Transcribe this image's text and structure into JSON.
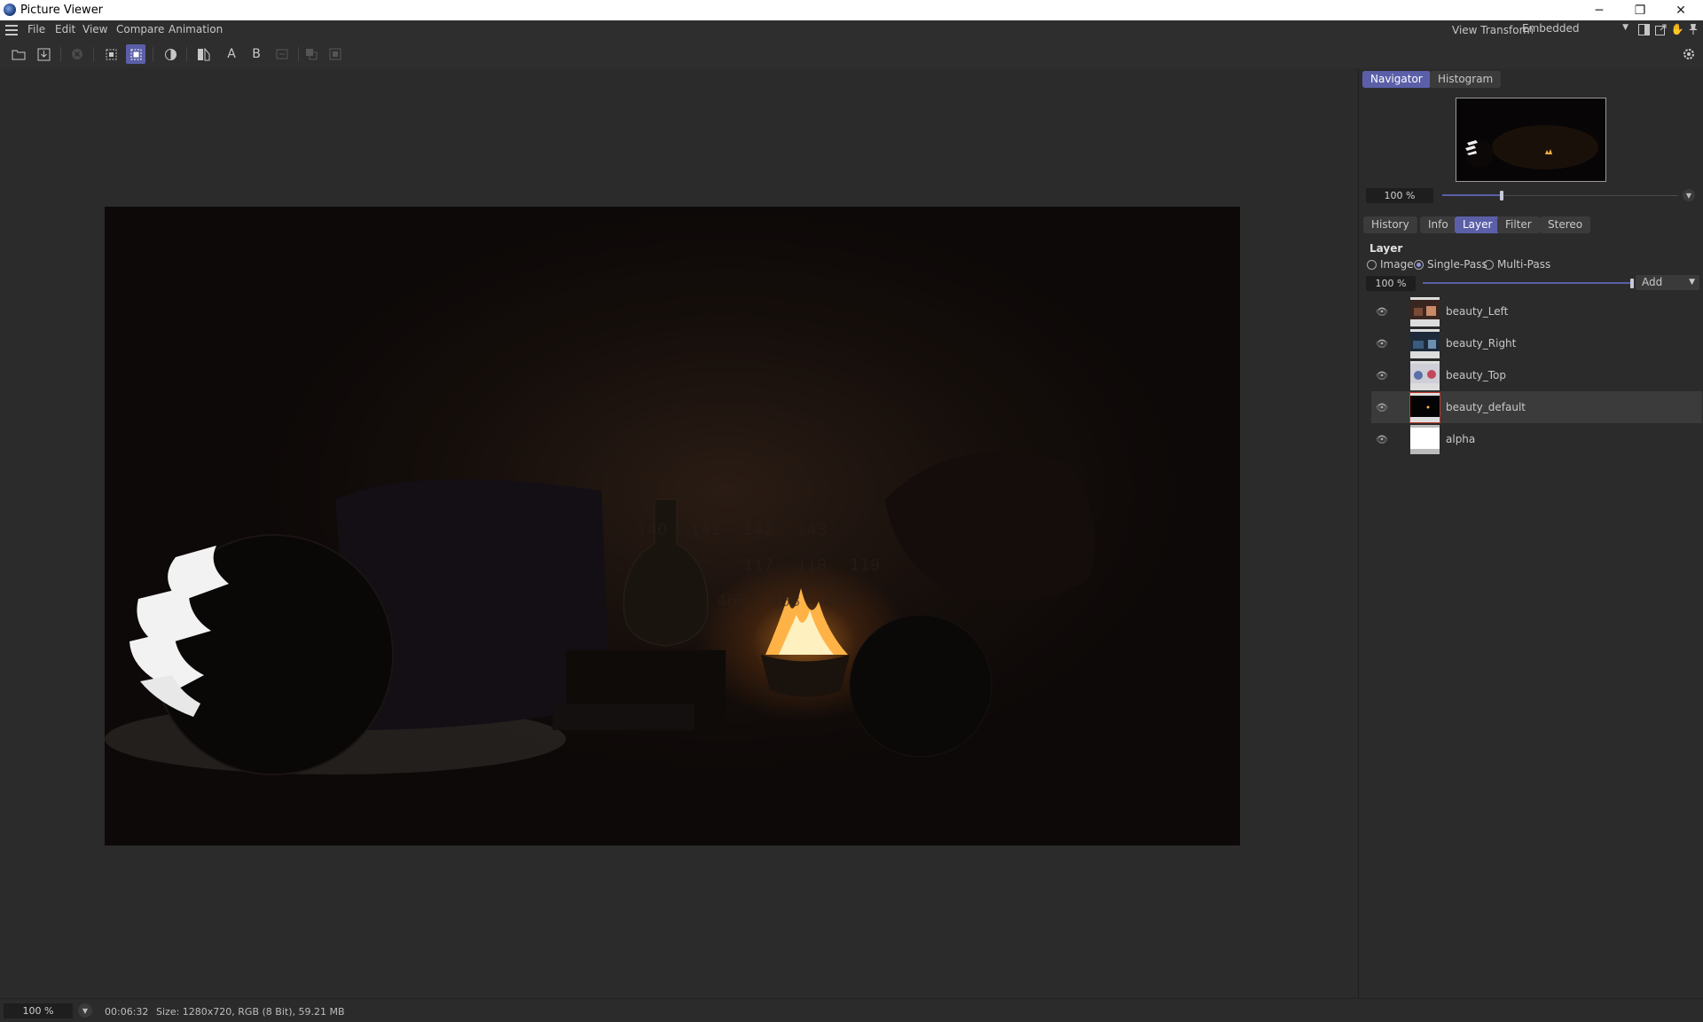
{
  "window": {
    "title": "Picture Viewer",
    "minimize": "─",
    "maximize": "❐",
    "close": "✕"
  },
  "menu": {
    "items": [
      "File",
      "Edit",
      "View",
      "Compare",
      "Animation"
    ],
    "view_transform_label": "View Transform",
    "view_transform_value": "Embedded"
  },
  "toolbar": {
    "label_a": "A",
    "label_b": "B"
  },
  "panel": {
    "top_tabs": [
      "Navigator",
      "Histogram"
    ],
    "active_top_tab": "Navigator",
    "navigator_zoom": "100 %",
    "navigator_zoom_fraction": 0.25,
    "tabs": [
      "History",
      "Info",
      "Layer",
      "Filter",
      "Stereo"
    ],
    "active_tab": "Layer",
    "layer": {
      "heading": "Layer",
      "modes": [
        "Image",
        "Single-Pass",
        "Multi-Pass"
      ],
      "selected_mode": "Single-Pass",
      "opacity": "100 %",
      "opacity_fraction": 1.0,
      "blend": "Add",
      "layers": [
        {
          "name": "beauty_Left",
          "visible": true,
          "selected": false
        },
        {
          "name": "beauty_Right",
          "visible": true,
          "selected": false
        },
        {
          "name": "beauty_Top",
          "visible": true,
          "selected": false
        },
        {
          "name": "beauty_default",
          "visible": true,
          "selected": true
        },
        {
          "name": "alpha",
          "visible": true,
          "selected": false
        }
      ]
    }
  },
  "status": {
    "zoom": "100 %",
    "time": "00:06:32",
    "info": "Size: 1280x720, RGB (8 Bit), 59.21 MB"
  },
  "colors": {
    "accent": "#5b5fa8",
    "background": "#2b2b2b",
    "text": "#c8c8c8"
  }
}
